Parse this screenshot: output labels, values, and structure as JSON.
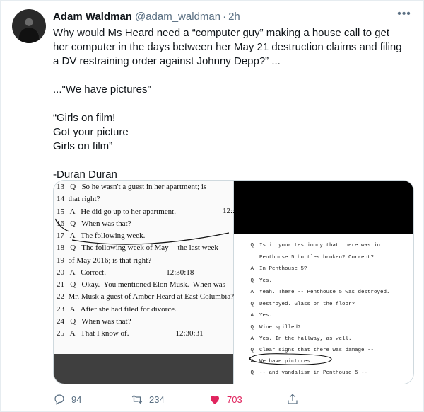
{
  "tweet": {
    "author_name": "Adam Waldman",
    "handle": "@adam_waldman",
    "separator": "·",
    "time": "2h",
    "more_label": "•••",
    "text": "Why would Ms Heard need a “computer guy” making a house call to get her computer in the days between her May 21 destruction claims and filing a DV restraining order against Johnny Depp?” ...\n\n...\"We have pictures”\n\n“Girls on film!\nGot your picture\nGirls on film”\n\n-Duran Duran"
  },
  "media": {
    "left_lines": [
      "13   Q   So he wasn't a guest in her apartment; is",
      "14  that right?",
      "15   A   He did go up to her apartment.",
      "16   Q   When was that?",
      "17   A   The following week.",
      "18   Q   The following week of May -- the last week",
      "19  of May 2016; is that right?",
      "20   A   Correct.                               12:30:18",
      "21   Q   Okay.  You mentioned Elon Musk.  When was",
      "22  Mr. Musk a guest of Amber Heard at East Columbia?",
      "23   A   After she had filed for divorce.",
      "24   Q   When was that?",
      "25   A   That I know of.                        12:30:31"
    ],
    "left_partial_time": "12::",
    "right_lines": [
      {
        "q": "Q",
        "t": "Is it your testimony that there was in"
      },
      {
        "q": "",
        "t": "Penthouse 5 bottles broken?  Correct?"
      },
      {
        "q": "A",
        "t": "In Penthouse 5?"
      },
      {
        "q": "Q",
        "t": "Yes."
      },
      {
        "q": "A",
        "t": "Yeah.  There -- Penthouse 5 was destroyed."
      },
      {
        "q": "Q",
        "t": "Destroyed.  Glass on the floor?"
      },
      {
        "q": "A",
        "t": "Yes."
      },
      {
        "q": "Q",
        "t": "Wine spilled?"
      },
      {
        "q": "A",
        "t": "Yes.  In the hallway, as well."
      },
      {
        "q": "Q",
        "t": "Clear signs that there was damage --"
      },
      {
        "q": "A",
        "t": "We have pictures."
      },
      {
        "q": "Q",
        "t": "-- and vandalism in Penthouse 5 --"
      }
    ]
  },
  "actions": {
    "reply_count": "94",
    "retweet_count": "234",
    "like_count": "703",
    "like_color": "#e0245e",
    "icons": [
      "reply-icon",
      "retweet-icon",
      "like-icon",
      "share-icon"
    ]
  }
}
